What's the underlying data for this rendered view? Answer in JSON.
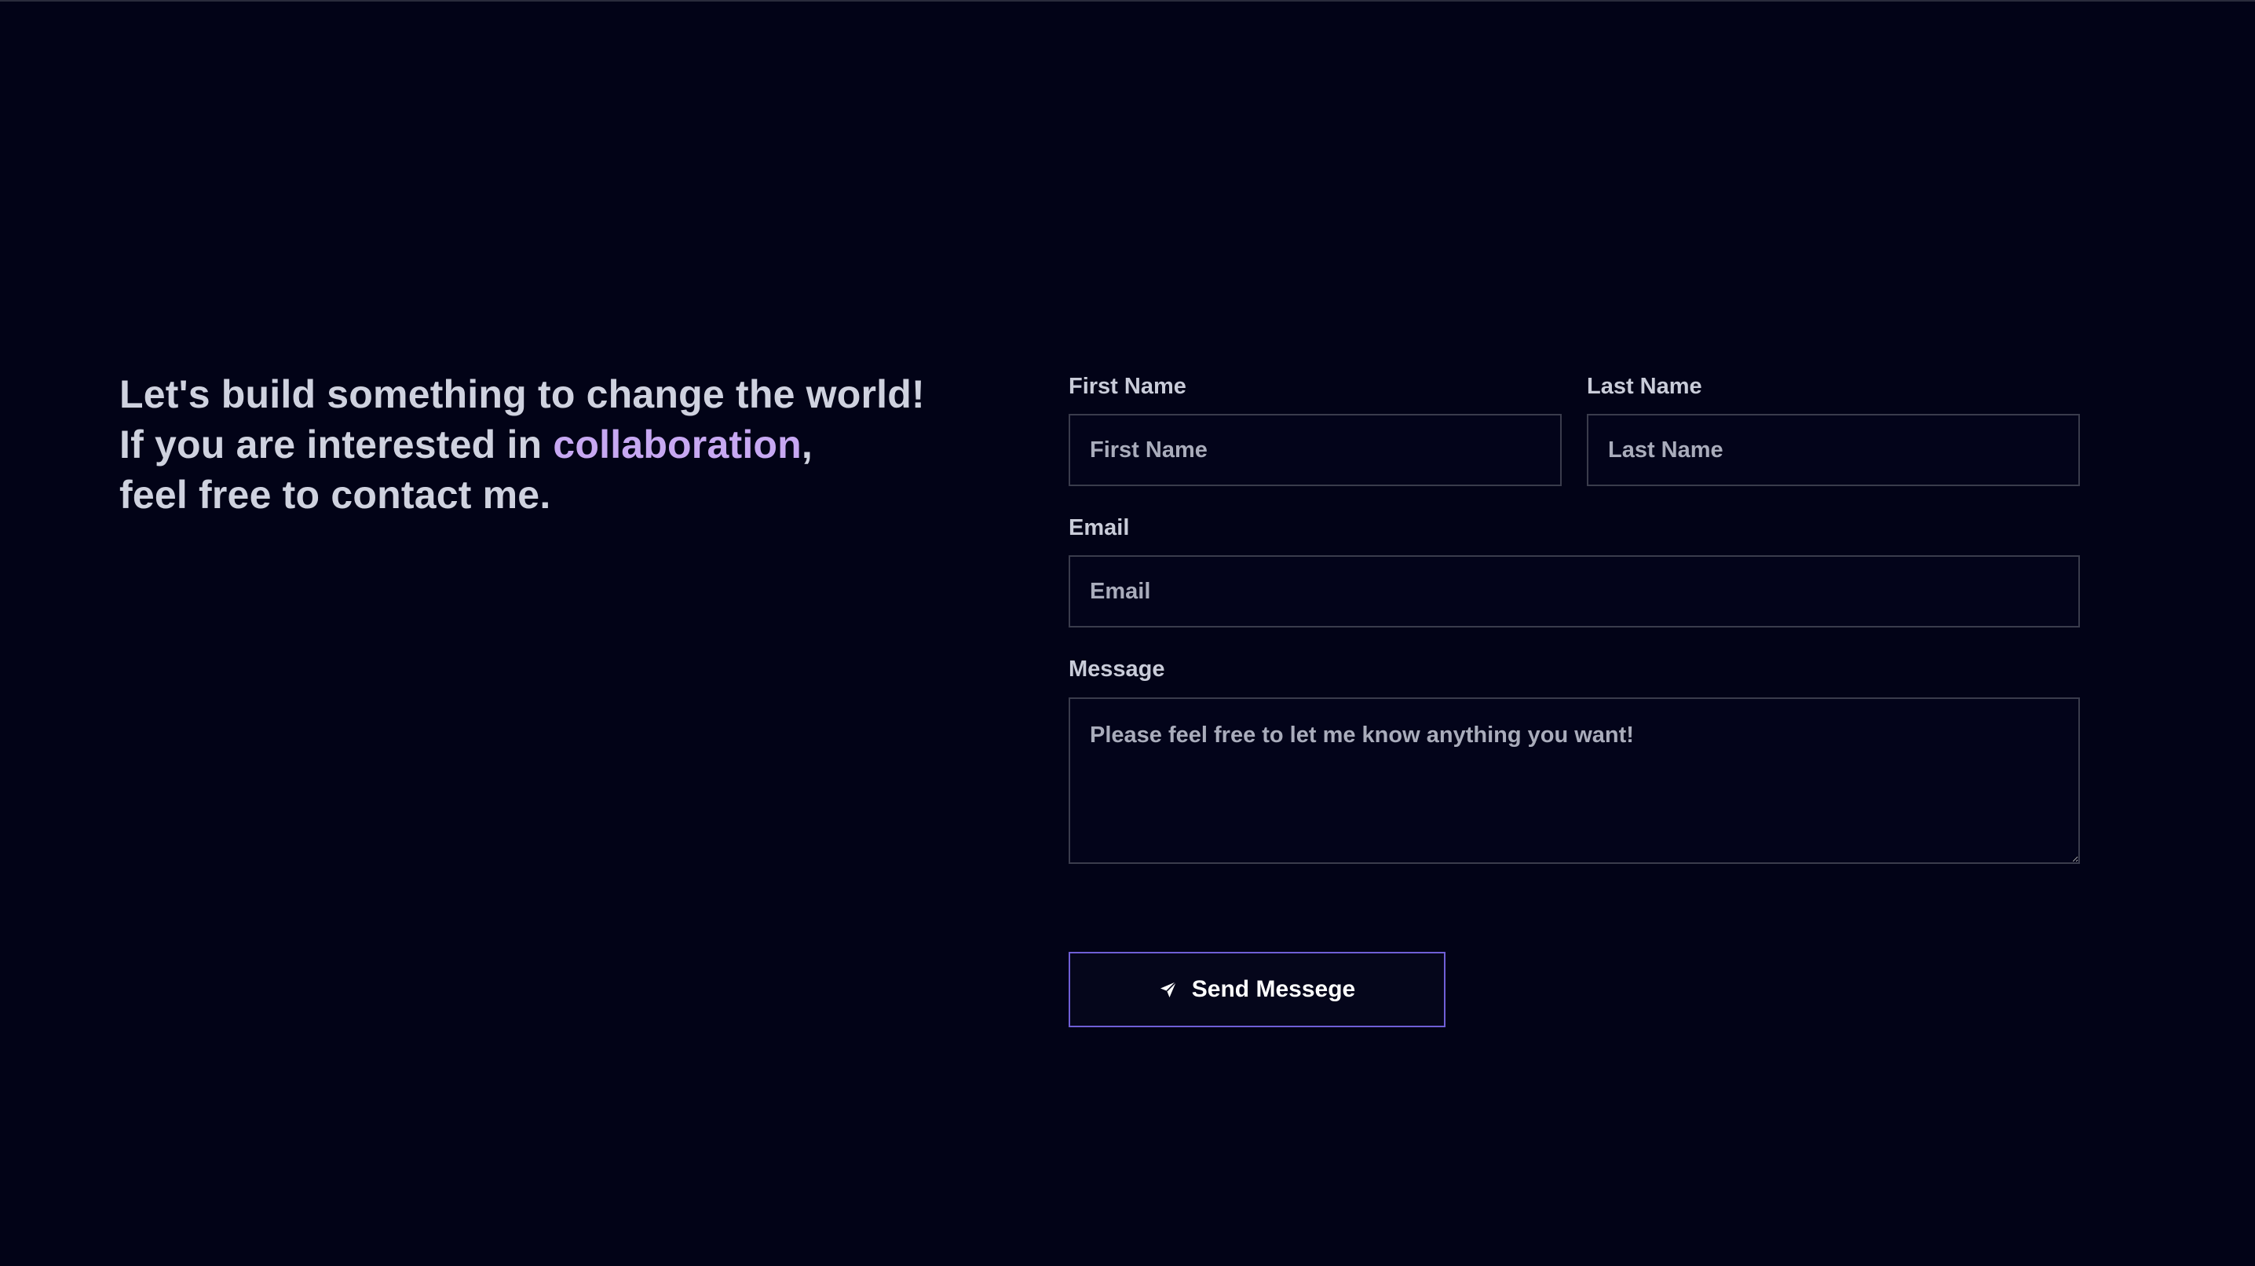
{
  "intro": {
    "line1": "Let's build something to change the world!",
    "line2_prefix": "If you are interested in ",
    "line2_highlight": "collaboration",
    "line2_suffix": ",",
    "line3": "feel free to contact me."
  },
  "form": {
    "first_name": {
      "label": "First Name",
      "placeholder": "First Name"
    },
    "last_name": {
      "label": "Last Name",
      "placeholder": "Last Name"
    },
    "email": {
      "label": "Email",
      "placeholder": "Email"
    },
    "message": {
      "label": "Message",
      "placeholder": "Please feel free to let me know anything you want!"
    },
    "submit": {
      "label": "Send Messege",
      "icon": "send-icon"
    }
  },
  "colors": {
    "background": "#020317",
    "text": "#cfd2df",
    "accent": "#c7a8f2",
    "button_border": "#6f5fd6"
  }
}
